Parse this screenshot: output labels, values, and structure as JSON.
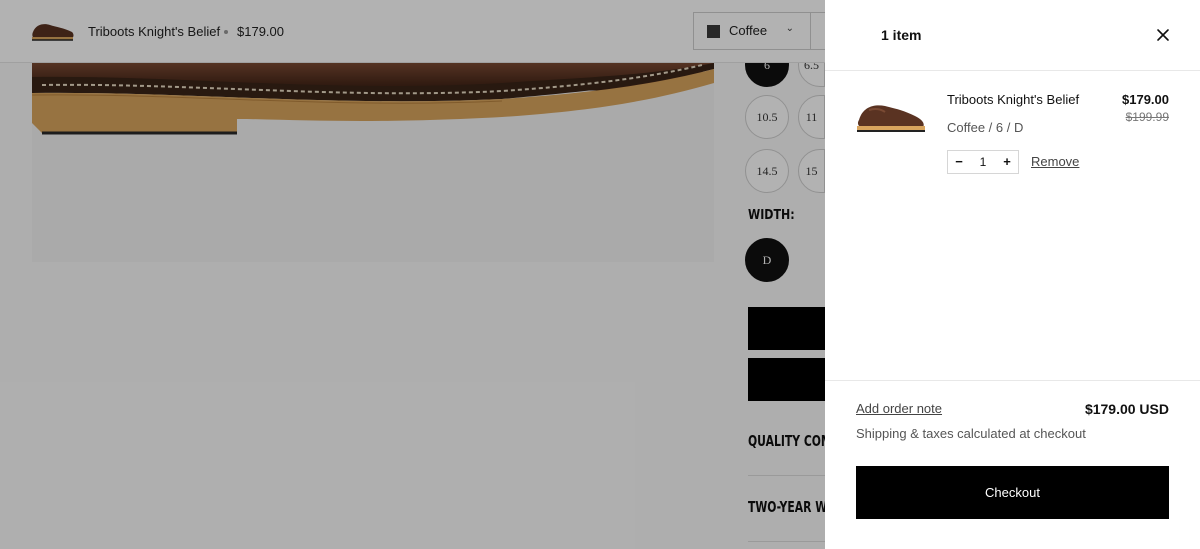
{
  "sticky_bar": {
    "product_title": "Triboots Knight's Belief",
    "price": "$179.00",
    "color_select": {
      "value": "Coffee",
      "swatch_color": "#3a3a3a"
    }
  },
  "product_page": {
    "sizes": [
      "6",
      "6.5",
      "10.5",
      "11",
      "14.5",
      "15"
    ],
    "selected_size": "6",
    "width_label": "WIDTH:",
    "width_options": [
      "D"
    ],
    "accordions": [
      "QUALITY COMMITMENT",
      "TWO-YEAR WARRANTY"
    ]
  },
  "cart": {
    "title": "1 item",
    "items": [
      {
        "name": "Triboots Knight's Belief",
        "variant": "Coffee / 6 / D",
        "price": "$179.00",
        "compare_price": "$199.99",
        "quantity": "1",
        "remove_label": "Remove"
      }
    ],
    "order_note_label": "Add order note",
    "subtotal": "$179.00 USD",
    "shipping_note": "Shipping & taxes calculated at checkout",
    "checkout_label": "Checkout"
  },
  "colors": {
    "accent": "#000000",
    "overlay": "rgba(0,0,0,0.30)",
    "leather": "#5a3322",
    "sole": "#d9a55e"
  }
}
